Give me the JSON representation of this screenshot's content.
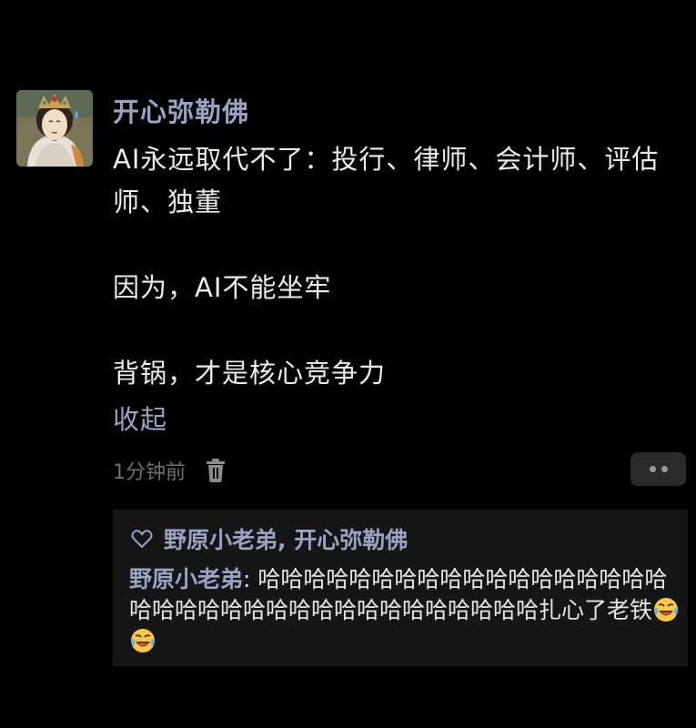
{
  "post": {
    "author": "开心弥勒佛",
    "content_lines": [
      "AI永远取代不了：投行、律师、会计师、评估师、独董",
      "因为，AI不能坐牢",
      "背锅，才是核心竞争力"
    ],
    "collapse_label": "收起",
    "timestamp": "1分钟前",
    "delete_icon": "trash-icon",
    "more_icon": "more-dots-icon"
  },
  "replies": {
    "likes_icon": "heart-outline-icon",
    "likes_text": "野原小老弟, 开心弥勒佛",
    "comment": {
      "author": "野原小老弟",
      "separator": ": ",
      "text": "哈哈哈哈哈哈哈哈哈哈哈哈哈哈哈哈哈哈哈哈哈哈哈哈哈哈哈哈哈哈哈哈哈哈哈哈扎心了老铁",
      "emojis": [
        "rolling-laughing-emoji",
        "rolling-laughing-emoji"
      ]
    }
  },
  "colors": {
    "background": "#000000",
    "name_accent": "#9aa3c2",
    "body_text": "#ececec",
    "muted_text": "#6f6f6f",
    "reply_panel": "#161616",
    "more_button": "#2a2a2a"
  }
}
